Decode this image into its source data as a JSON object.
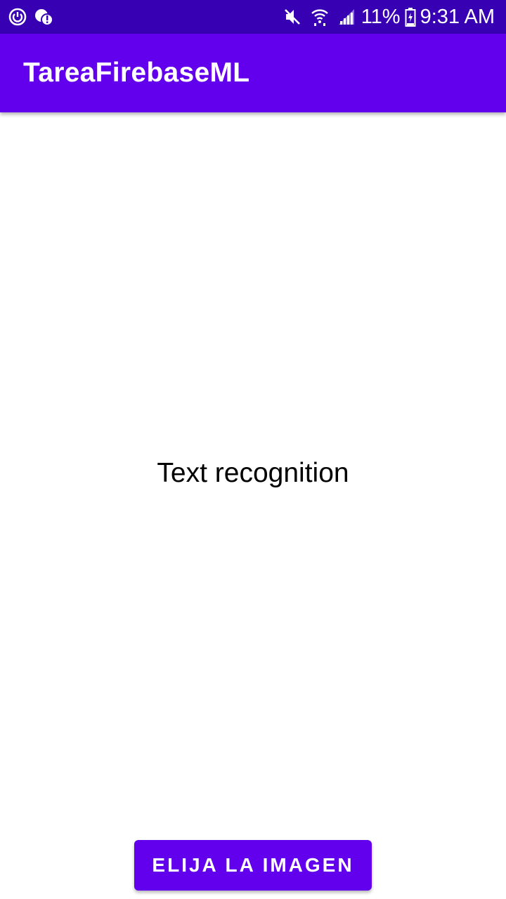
{
  "status_bar": {
    "left_icons": [
      "sync-icon",
      "notification-alert-icon"
    ],
    "right_icons": [
      "mute-icon",
      "wifi-icon",
      "signal-icon",
      "battery-icon"
    ],
    "battery_text": "11%",
    "time": "9:31 AM"
  },
  "app_bar": {
    "title": "TareaFirebaseML",
    "color": "#6200ee"
  },
  "main": {
    "text": "Text recognition"
  },
  "button": {
    "label": "ELIJA LA IMAGEN",
    "color": "#6200ee"
  },
  "colors": {
    "status_bar": "#3700b3",
    "primary": "#6200ee",
    "background": "#ffffff"
  }
}
